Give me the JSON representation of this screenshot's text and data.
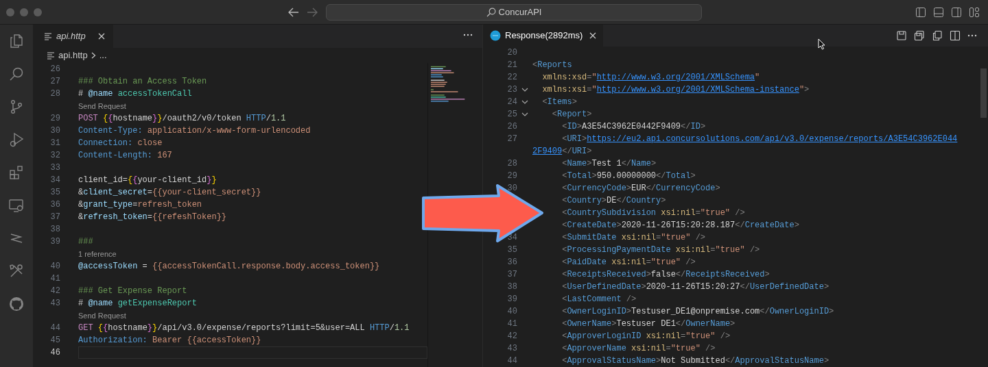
{
  "window": {
    "search_title": "ConcurAPI"
  },
  "left_editor": {
    "tab": {
      "label": "api.http",
      "selected": true,
      "preview": true
    },
    "breadcrumb": [
      "api.http",
      "..."
    ],
    "lines": [
      {
        "kind": "code",
        "number": "26"
      },
      {
        "kind": "code",
        "number": "27",
        "tokens": [
          {
            "kind": "comment",
            "text": "### Obtain an Access Token"
          }
        ]
      },
      {
        "kind": "code",
        "number": "28",
        "tokens": [
          {
            "kind": "plain",
            "text": "# "
          },
          {
            "kind": "variable",
            "text": "@name "
          },
          {
            "kind": "name",
            "text": "accessTokenCall"
          }
        ]
      },
      {
        "kind": "lens",
        "text": "Send Request"
      },
      {
        "kind": "code",
        "number": "29",
        "tokens": [
          {
            "kind": "method",
            "text": "POST "
          },
          {
            "kind": "bracket1",
            "text": "{"
          },
          {
            "kind": "bracket2",
            "text": "{"
          },
          {
            "kind": "plain",
            "text": "hostname"
          },
          {
            "kind": "bracket2",
            "text": "}"
          },
          {
            "kind": "bracket1",
            "text": "}"
          },
          {
            "kind": "plain",
            "text": "/oauth2/v0/token "
          },
          {
            "kind": "keyword",
            "text": "HTTP"
          },
          {
            "kind": "plain",
            "text": "/"
          },
          {
            "kind": "number",
            "text": "1.1"
          }
        ]
      },
      {
        "kind": "code",
        "number": "30",
        "tokens": [
          {
            "kind": "keyword",
            "text": "Content-Type: "
          },
          {
            "kind": "value",
            "text": "application/x-www-form-urlencoded"
          }
        ]
      },
      {
        "kind": "code",
        "number": "31",
        "tokens": [
          {
            "kind": "keyword",
            "text": "Connection: "
          },
          {
            "kind": "value",
            "text": "close"
          }
        ]
      },
      {
        "kind": "code",
        "number": "32",
        "tokens": [
          {
            "kind": "keyword",
            "text": "Content-Length: "
          },
          {
            "kind": "value",
            "text": "167"
          }
        ]
      },
      {
        "kind": "code",
        "number": "33"
      },
      {
        "kind": "code",
        "number": "34",
        "tokens": [
          {
            "kind": "plain",
            "text": "client_id="
          },
          {
            "kind": "bracket1",
            "text": "{"
          },
          {
            "kind": "bracket2",
            "text": "{"
          },
          {
            "kind": "plain",
            "text": "your-client_id"
          },
          {
            "kind": "bracket2",
            "text": "}"
          },
          {
            "kind": "bracket1",
            "text": "}"
          }
        ]
      },
      {
        "kind": "code",
        "number": "35",
        "tokens": [
          {
            "kind": "plain",
            "text": "&"
          },
          {
            "kind": "variable",
            "text": "client_secret"
          },
          {
            "kind": "plain",
            "text": "="
          },
          {
            "kind": "value",
            "text": "{{your-client_secret}}"
          }
        ]
      },
      {
        "kind": "code",
        "number": "36",
        "tokens": [
          {
            "kind": "plain",
            "text": "&"
          },
          {
            "kind": "variable",
            "text": "grant_type"
          },
          {
            "kind": "plain",
            "text": "="
          },
          {
            "kind": "value",
            "text": "refresh_token"
          }
        ]
      },
      {
        "kind": "code",
        "number": "37",
        "tokens": [
          {
            "kind": "plain",
            "text": "&"
          },
          {
            "kind": "variable",
            "text": "refresh_token"
          },
          {
            "kind": "plain",
            "text": "="
          },
          {
            "kind": "value",
            "text": "{{refeshToken}}"
          }
        ]
      },
      {
        "kind": "code",
        "number": "38"
      },
      {
        "kind": "code",
        "number": "39",
        "tokens": [
          {
            "kind": "comment",
            "text": "###"
          }
        ]
      },
      {
        "kind": "lens",
        "text": "1 reference"
      },
      {
        "kind": "code",
        "number": "40",
        "tokens": [
          {
            "kind": "variable",
            "text": "@accessToken"
          },
          {
            "kind": "plain",
            "text": " = "
          },
          {
            "kind": "value",
            "text": "{{accessTokenCall.response.body.access_token}}"
          }
        ]
      },
      {
        "kind": "code",
        "number": "41"
      },
      {
        "kind": "code",
        "number": "42",
        "tokens": [
          {
            "kind": "comment",
            "text": "### Get Expense Report"
          }
        ]
      },
      {
        "kind": "code",
        "number": "43",
        "tokens": [
          {
            "kind": "plain",
            "text": "# "
          },
          {
            "kind": "variable",
            "text": "@name "
          },
          {
            "kind": "name",
            "text": "getExpenseReport"
          }
        ]
      },
      {
        "kind": "lens",
        "text": "Send Request"
      },
      {
        "kind": "code",
        "number": "44",
        "tokens": [
          {
            "kind": "method",
            "text": "GET "
          },
          {
            "kind": "bracket1",
            "text": "{"
          },
          {
            "kind": "bracket2",
            "text": "{"
          },
          {
            "kind": "plain",
            "text": "hostname"
          },
          {
            "kind": "bracket2",
            "text": "}"
          },
          {
            "kind": "bracket1",
            "text": "}"
          },
          {
            "kind": "plain",
            "text": "/api/v3.0/expense/reports?limit=5&user=ALL "
          },
          {
            "kind": "keyword",
            "text": "HTTP"
          },
          {
            "kind": "plain",
            "text": "/"
          },
          {
            "kind": "number",
            "text": "1.1"
          }
        ]
      },
      {
        "kind": "code",
        "number": "45",
        "tokens": [
          {
            "kind": "keyword",
            "text": "Authorization: "
          },
          {
            "kind": "value",
            "text": "Bearer {{accessToken}}"
          }
        ]
      },
      {
        "kind": "code",
        "number": "46",
        "current": true
      }
    ]
  },
  "right_editor": {
    "tab": {
      "label": "Response(2892ms)",
      "selected": true,
      "preview": false
    },
    "lines": [
      {
        "kind": "code",
        "number": "20"
      },
      {
        "kind": "code",
        "number": "21",
        "tokens": [
          {
            "kind": "punct",
            "text": "<"
          },
          {
            "kind": "tag",
            "text": "Reports"
          }
        ]
      },
      {
        "kind": "code",
        "number": "22",
        "tokens": [
          {
            "kind": "attr",
            "text": "  xmlns:xsd"
          },
          {
            "kind": "punct",
            "text": "="
          },
          {
            "kind": "string",
            "text": "\""
          },
          {
            "kind": "link",
            "text": "http://www.w3.org/2001/XMLSchema"
          },
          {
            "kind": "string",
            "text": "\""
          }
        ]
      },
      {
        "kind": "code",
        "number": "23",
        "fold": true,
        "tokens": [
          {
            "kind": "attr",
            "text": "  xmlns:xsi"
          },
          {
            "kind": "punct",
            "text": "="
          },
          {
            "kind": "string",
            "text": "\""
          },
          {
            "kind": "link",
            "text": "http://www.w3.org/2001/XMLSchema-instance"
          },
          {
            "kind": "string",
            "text": "\""
          },
          {
            "kind": "punct",
            "text": ">"
          }
        ]
      },
      {
        "kind": "code",
        "number": "24",
        "fold": true,
        "tokens": [
          {
            "kind": "punct",
            "text": "  <"
          },
          {
            "kind": "tag",
            "text": "Items"
          },
          {
            "kind": "punct",
            "text": ">"
          }
        ]
      },
      {
        "kind": "code",
        "number": "25",
        "fold": true,
        "tokens": [
          {
            "kind": "punct",
            "text": "    <"
          },
          {
            "kind": "tag",
            "text": "Report"
          },
          {
            "kind": "punct",
            "text": ">"
          }
        ]
      },
      {
        "kind": "code",
        "number": "26",
        "tokens": [
          {
            "kind": "punct",
            "text": "      <"
          },
          {
            "kind": "tag",
            "text": "ID"
          },
          {
            "kind": "punct",
            "text": ">"
          },
          {
            "kind": "plain",
            "text": "A3E54C3962E0442F9409"
          },
          {
            "kind": "punct",
            "text": "</"
          },
          {
            "kind": "tag",
            "text": "ID"
          },
          {
            "kind": "punct",
            "text": ">"
          }
        ]
      },
      {
        "kind": "code",
        "number": "27",
        "tokens": [
          {
            "kind": "punct",
            "text": "      <"
          },
          {
            "kind": "tag",
            "text": "URI"
          },
          {
            "kind": "punct",
            "text": ">"
          },
          {
            "kind": "link",
            "text": "https://eu2.api.concursolutions.com/api/v3.0/expense/reports/A3E54C3962E044"
          }
        ]
      },
      {
        "kind": "code",
        "tokens": [
          {
            "kind": "link",
            "text": "2F9409"
          },
          {
            "kind": "punct",
            "text": "</"
          },
          {
            "kind": "tag",
            "text": "URI"
          },
          {
            "kind": "punct",
            "text": ">"
          }
        ]
      },
      {
        "kind": "code",
        "number": "28",
        "tokens": [
          {
            "kind": "punct",
            "text": "      <"
          },
          {
            "kind": "tag",
            "text": "Name"
          },
          {
            "kind": "punct",
            "text": ">"
          },
          {
            "kind": "plain",
            "text": "Test 1"
          },
          {
            "kind": "punct",
            "text": "</"
          },
          {
            "kind": "tag",
            "text": "Name"
          },
          {
            "kind": "punct",
            "text": ">"
          }
        ]
      },
      {
        "kind": "code",
        "number": "29",
        "tokens": [
          {
            "kind": "punct",
            "text": "      <"
          },
          {
            "kind": "tag",
            "text": "Total"
          },
          {
            "kind": "punct",
            "text": ">"
          },
          {
            "kind": "plain",
            "text": "950.00000000"
          },
          {
            "kind": "punct",
            "text": "</"
          },
          {
            "kind": "tag",
            "text": "Total"
          },
          {
            "kind": "punct",
            "text": ">"
          }
        ]
      },
      {
        "kind": "code",
        "number": "30",
        "tokens": [
          {
            "kind": "punct",
            "text": "      <"
          },
          {
            "kind": "tag",
            "text": "CurrencyCode"
          },
          {
            "kind": "punct",
            "text": ">"
          },
          {
            "kind": "plain",
            "text": "EUR"
          },
          {
            "kind": "punct",
            "text": "</"
          },
          {
            "kind": "tag",
            "text": "CurrencyCode"
          },
          {
            "kind": "punct",
            "text": ">"
          }
        ]
      },
      {
        "kind": "code",
        "tokens": [
          {
            "kind": "punct",
            "text": "      <"
          },
          {
            "kind": "tag",
            "text": "Country"
          },
          {
            "kind": "punct",
            "text": ">"
          },
          {
            "kind": "plain",
            "text": "DE"
          },
          {
            "kind": "punct",
            "text": "</"
          },
          {
            "kind": "tag",
            "text": "Country"
          },
          {
            "kind": "punct",
            "text": ">"
          }
        ]
      },
      {
        "kind": "code",
        "tokens": [
          {
            "kind": "punct",
            "text": "      <"
          },
          {
            "kind": "tag",
            "text": "CountrySubdivision"
          },
          {
            "kind": "attr",
            "text": " xsi:nil"
          },
          {
            "kind": "punct",
            "text": "="
          },
          {
            "kind": "string",
            "text": "\"true\""
          },
          {
            "kind": "punct",
            "text": " />"
          }
        ]
      },
      {
        "kind": "code",
        "tokens": [
          {
            "kind": "punct",
            "text": "      <"
          },
          {
            "kind": "tag",
            "text": "CreateDate"
          },
          {
            "kind": "punct",
            "text": ">"
          },
          {
            "kind": "plain",
            "text": "2020-11-26T15:20:28.187"
          },
          {
            "kind": "punct",
            "text": "</"
          },
          {
            "kind": "tag",
            "text": "CreateDate"
          },
          {
            "kind": "punct",
            "text": ">"
          }
        ]
      },
      {
        "kind": "code",
        "number": "34",
        "tokens": [
          {
            "kind": "punct",
            "text": "      <"
          },
          {
            "kind": "tag",
            "text": "SubmitDate"
          },
          {
            "kind": "attr",
            "text": " xsi:nil"
          },
          {
            "kind": "punct",
            "text": "="
          },
          {
            "kind": "string",
            "text": "\"true\""
          },
          {
            "kind": "punct",
            "text": " />"
          }
        ]
      },
      {
        "kind": "code",
        "number": "35",
        "tokens": [
          {
            "kind": "punct",
            "text": "      <"
          },
          {
            "kind": "tag",
            "text": "ProcessingPaymentDate"
          },
          {
            "kind": "attr",
            "text": " xsi:nil"
          },
          {
            "kind": "punct",
            "text": "="
          },
          {
            "kind": "string",
            "text": "\"true\""
          },
          {
            "kind": "punct",
            "text": " />"
          }
        ]
      },
      {
        "kind": "code",
        "number": "36",
        "tokens": [
          {
            "kind": "punct",
            "text": "      <"
          },
          {
            "kind": "tag",
            "text": "PaidDate"
          },
          {
            "kind": "attr",
            "text": " xsi:nil"
          },
          {
            "kind": "punct",
            "text": "="
          },
          {
            "kind": "string",
            "text": "\"true\""
          },
          {
            "kind": "punct",
            "text": " />"
          }
        ]
      },
      {
        "kind": "code",
        "number": "37",
        "tokens": [
          {
            "kind": "punct",
            "text": "      <"
          },
          {
            "kind": "tag",
            "text": "ReceiptsReceived"
          },
          {
            "kind": "punct",
            "text": ">"
          },
          {
            "kind": "plain",
            "text": "false"
          },
          {
            "kind": "punct",
            "text": "</"
          },
          {
            "kind": "tag",
            "text": "ReceiptsReceived"
          },
          {
            "kind": "punct",
            "text": ">"
          }
        ]
      },
      {
        "kind": "code",
        "number": "38",
        "tokens": [
          {
            "kind": "punct",
            "text": "      <"
          },
          {
            "kind": "tag",
            "text": "UserDefinedDate"
          },
          {
            "kind": "punct",
            "text": ">"
          },
          {
            "kind": "plain",
            "text": "2020-11-26T15:20:27"
          },
          {
            "kind": "punct",
            "text": "</"
          },
          {
            "kind": "tag",
            "text": "UserDefinedDate"
          },
          {
            "kind": "punct",
            "text": ">"
          }
        ]
      },
      {
        "kind": "code",
        "number": "39",
        "tokens": [
          {
            "kind": "punct",
            "text": "      <"
          },
          {
            "kind": "tag",
            "text": "LastComment"
          },
          {
            "kind": "punct",
            "text": " />"
          }
        ]
      },
      {
        "kind": "code",
        "number": "40",
        "tokens": [
          {
            "kind": "punct",
            "text": "      <"
          },
          {
            "kind": "tag",
            "text": "OwnerLoginID"
          },
          {
            "kind": "punct",
            "text": ">"
          },
          {
            "kind": "plain",
            "text": "Testuser_DE1@onpremise.com"
          },
          {
            "kind": "punct",
            "text": "</"
          },
          {
            "kind": "tag",
            "text": "OwnerLoginID"
          },
          {
            "kind": "punct",
            "text": ">"
          }
        ]
      },
      {
        "kind": "code",
        "number": "41",
        "tokens": [
          {
            "kind": "punct",
            "text": "      <"
          },
          {
            "kind": "tag",
            "text": "OwnerName"
          },
          {
            "kind": "punct",
            "text": ">"
          },
          {
            "kind": "plain",
            "text": "Testuser DE1"
          },
          {
            "kind": "punct",
            "text": "</"
          },
          {
            "kind": "tag",
            "text": "OwnerName"
          },
          {
            "kind": "punct",
            "text": ">"
          }
        ]
      },
      {
        "kind": "code",
        "number": "42",
        "tokens": [
          {
            "kind": "punct",
            "text": "      <"
          },
          {
            "kind": "tag",
            "text": "ApproverLoginID"
          },
          {
            "kind": "attr",
            "text": " xsi:nil"
          },
          {
            "kind": "punct",
            "text": "="
          },
          {
            "kind": "string",
            "text": "\"true\""
          },
          {
            "kind": "punct",
            "text": " />"
          }
        ]
      },
      {
        "kind": "code",
        "number": "43",
        "tokens": [
          {
            "kind": "punct",
            "text": "      <"
          },
          {
            "kind": "tag",
            "text": "ApproverName"
          },
          {
            "kind": "attr",
            "text": " xsi:nil"
          },
          {
            "kind": "punct",
            "text": "="
          },
          {
            "kind": "string",
            "text": "\"true\""
          },
          {
            "kind": "punct",
            "text": " />"
          }
        ]
      },
      {
        "kind": "code",
        "number": "44",
        "tokens": [
          {
            "kind": "punct",
            "text": "      <"
          },
          {
            "kind": "tag",
            "text": "ApprovalStatusName"
          },
          {
            "kind": "punct",
            "text": ">"
          },
          {
            "kind": "plain",
            "text": "Not Submitted"
          },
          {
            "kind": "punct",
            "text": "</"
          },
          {
            "kind": "tag",
            "text": "ApprovalStatusName"
          },
          {
            "kind": "punct",
            "text": ">"
          }
        ]
      }
    ]
  }
}
